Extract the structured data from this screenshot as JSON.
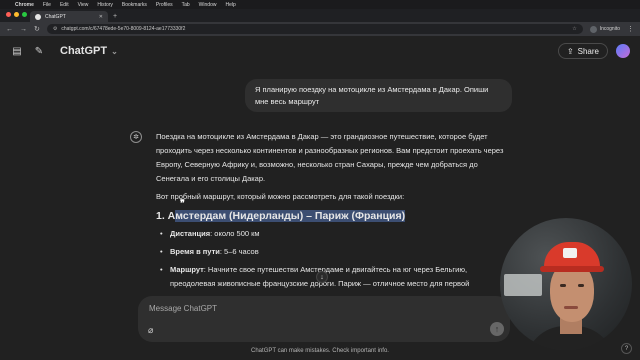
{
  "menubar": {
    "items": [
      "Chrome",
      "File",
      "Edit",
      "View",
      "History",
      "Bookmarks",
      "Profiles",
      "Tab",
      "Window",
      "Help"
    ]
  },
  "browser": {
    "tab_title": "ChatGPT",
    "url": "chatgpt.com/c/67478ede-5e70-8009-8124-ae1773330f2",
    "profile_label": "Incognito"
  },
  "header": {
    "model_label": "ChatGPT",
    "share_label": "Share"
  },
  "conversation": {
    "user_message": "Я планирую поездку на мотоцикле из Амстердама в Дакар. Опиши мне весь маршрут",
    "intro": "Поездка на мотоцикле из Амстердама в Дакар — это грандиозное путешествие, которое будет проходить через несколько континентов и разнообразных регионов. Вам предстоит проехать через Европу, Северную Африку и, возможно, несколько стран Сахары, прежде чем добраться до Сенегала и его столицы Дакар.",
    "lead_prefix": "Вот п",
    "lead_suffix": "робный маршрут, который можно рассмотреть для такой поездки:",
    "section_number": "1. А",
    "section_title_rest": "мстердам (Нидерланды) – Париж (Франция)",
    "bullets": [
      {
        "label": "Дистанция",
        "text": ": около 500 км"
      },
      {
        "label": "Время в пути",
        "text": ": 5–6 часов"
      },
      {
        "label": "Маршрут",
        "text": ": Начните свое путешестви  Амстердаме и двигайтесь на юг через Бельгию, преодолевая живописные французские дороги. Париж — отличное место для первой"
      }
    ]
  },
  "composer": {
    "placeholder": "Message ChatGPT"
  },
  "footer": {
    "disclaimer": "ChatGPT can make mistakes. Check important info.",
    "help": "?"
  }
}
